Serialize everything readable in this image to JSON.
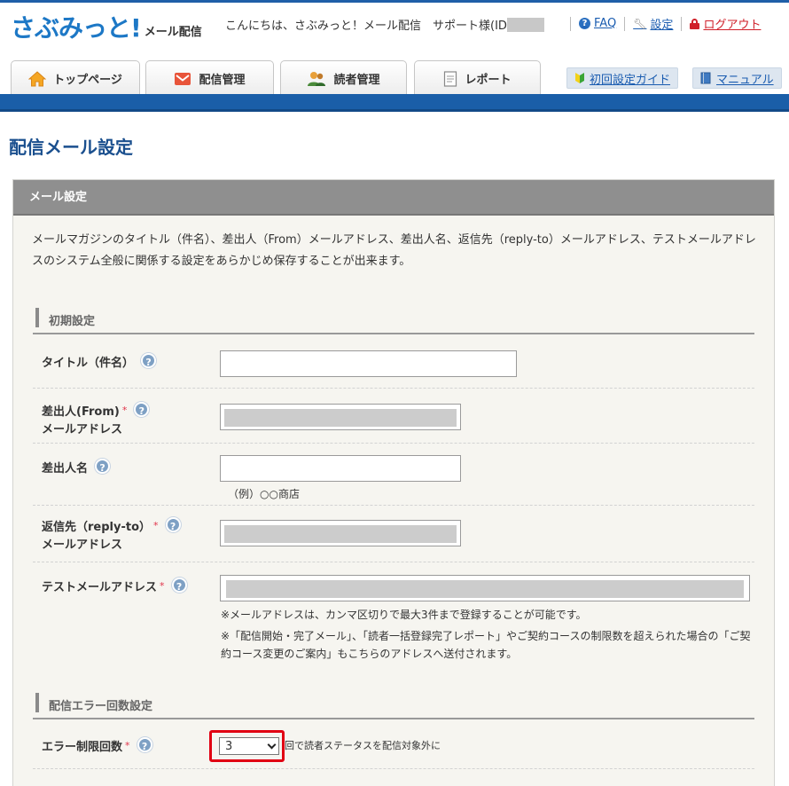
{
  "header": {
    "logo_main": "さぶみっと!",
    "logo_sub": "メール配信",
    "greeting_prefix": "こんにちは、さぶみっと！メール配信　サポート様(ID",
    "links": {
      "faq": "FAQ",
      "settings": "設定",
      "logout": "ログアウト"
    }
  },
  "nav": {
    "tabs": [
      {
        "label": "トップページ",
        "icon": "home-icon"
      },
      {
        "label": "配信管理",
        "icon": "mail-icon"
      },
      {
        "label": "読者管理",
        "icon": "users-icon"
      },
      {
        "label": "レポート",
        "icon": "report-icon"
      }
    ],
    "guide_button": "初回設定ガイド",
    "manual_button": "マニュアル"
  },
  "page": {
    "title": "配信メール設定",
    "panel_title": "メール設定",
    "intro": "メールマガジンのタイトル（件名）、差出人（From）メールアドレス、差出人名、返信先（reply-to）メールアドレス、テストメールアドレスのシステム全般に関係する設定をあらかじめ保存することが出来ます。"
  },
  "initial_section": {
    "title": "初期設定",
    "title_field": {
      "label": "タイトル（件名）",
      "value": ""
    },
    "from_field": {
      "label_line1": "差出人(From)",
      "label_line2": "メールアドレス",
      "required_mark": "*"
    },
    "sender_name_field": {
      "label": "差出人名",
      "value": "",
      "example": "（例）○○商店"
    },
    "reply_field": {
      "label_line1": "返信先（reply-to）",
      "label_line2": "メールアドレス",
      "required_mark": "*"
    },
    "test_field": {
      "label": "テストメールアドレス",
      "required_mark": "*",
      "note1": "※メールアドレスは、カンマ区切りで最大3件まで登録することが可能です。",
      "note2": "※「配信開始・完了メール」、「読者一括登録完了レポート」やご契約コースの制限数を超えられた場合の「ご契約コース変更のご案内」もこちらのアドレスへ送付されます。"
    }
  },
  "error_section": {
    "title": "配信エラー回数設定",
    "limit_field": {
      "label": "エラー制限回数",
      "required_mark": "*",
      "selected": "3",
      "suffix": "回で読者ステータスを配信対象外に"
    }
  },
  "colors": {
    "brand": "#1d78c6",
    "nav": "#1a5ea8",
    "highlight": "#e10012",
    "title": "#1a4f8e"
  }
}
